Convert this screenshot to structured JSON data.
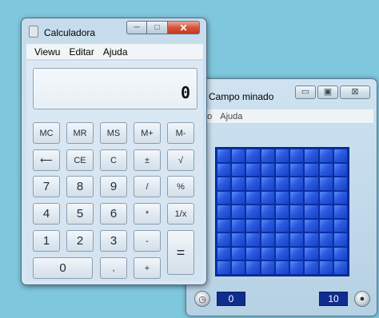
{
  "minesweeper": {
    "title": "Campo minado",
    "menu": [
      "go",
      "Ajuda"
    ],
    "controls": {
      "minimize": "▭",
      "maximize": "▣",
      "close": "⊠"
    },
    "grid": {
      "rows": 9,
      "cols": 9
    },
    "time_value": "0",
    "mines_value": "10",
    "time_icon": "clock-icon",
    "mines_icon": "mine-icon"
  },
  "calculator": {
    "title": "Calculadora",
    "menu": [
      "Viewu",
      "Editar",
      "Ajuda"
    ],
    "controls": {
      "minimize": "─",
      "maximize": "□",
      "close": "✕"
    },
    "display": "0",
    "keys": [
      {
        "id": "mc",
        "label": "MC"
      },
      {
        "id": "mr",
        "label": "MR"
      },
      {
        "id": "ms",
        "label": "MS"
      },
      {
        "id": "mplus",
        "label": "M+"
      },
      {
        "id": "mminus",
        "label": "M-"
      },
      {
        "id": "backspace",
        "label": "⟵"
      },
      {
        "id": "ce",
        "label": "CE"
      },
      {
        "id": "c",
        "label": "C"
      },
      {
        "id": "plusminus",
        "label": "±"
      },
      {
        "id": "sqrt",
        "label": "√"
      },
      {
        "id": "7",
        "label": "7"
      },
      {
        "id": "8",
        "label": "8"
      },
      {
        "id": "9",
        "label": "9"
      },
      {
        "id": "divide",
        "label": "/"
      },
      {
        "id": "percent",
        "label": "%"
      },
      {
        "id": "4",
        "label": "4"
      },
      {
        "id": "5",
        "label": "5"
      },
      {
        "id": "6",
        "label": "6"
      },
      {
        "id": "multiply",
        "label": "*"
      },
      {
        "id": "reciprocal",
        "label": "1/x"
      },
      {
        "id": "1",
        "label": "1"
      },
      {
        "id": "2",
        "label": "2"
      },
      {
        "id": "3",
        "label": "3"
      },
      {
        "id": "subtract",
        "label": "-"
      },
      {
        "id": "equals",
        "label": "="
      },
      {
        "id": "0",
        "label": "0"
      },
      {
        "id": "decimal",
        "label": ","
      },
      {
        "id": "add",
        "label": "+"
      }
    ]
  },
  "colors": {
    "desktop": "#7fc7dd",
    "mine_tile": "#2a5ae0",
    "close_button": "#c23b22"
  }
}
